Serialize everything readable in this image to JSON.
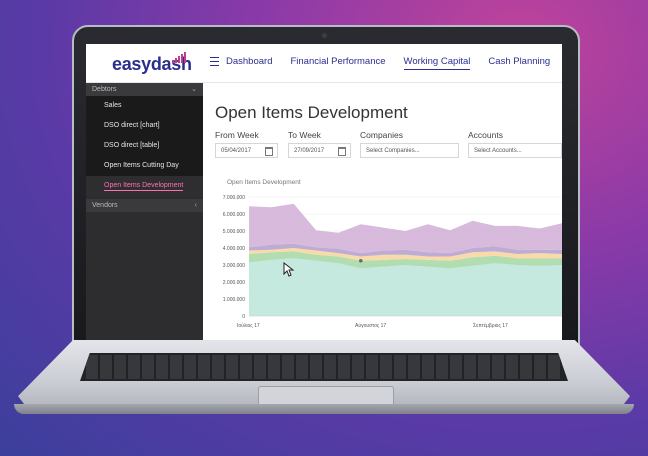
{
  "app": {
    "logo": {
      "easy": "easy",
      "dash": "dash"
    },
    "nav": {
      "items": [
        "Dashboard",
        "Financial Performance",
        "Working Capital",
        "Cash Planning"
      ],
      "active": "Working Capital"
    }
  },
  "sidebar": {
    "debtors_label": "Debtors",
    "items": [
      "Sales",
      "DSO direct [chart]",
      "DSO direct [table]",
      "Open Items Cutting Day",
      "Open Items Development"
    ],
    "active_item": "Open Items Development",
    "vendors_label": "Vendors"
  },
  "page": {
    "title": "Open Items Development",
    "filters": {
      "from_week": {
        "label": "From Week",
        "value": "05/04/2017"
      },
      "to_week": {
        "label": "To Week",
        "value": "27/09/2017"
      },
      "companies": {
        "label": "Companies",
        "placeholder": "Select Companies..."
      },
      "accounts": {
        "label": "Accounts",
        "placeholder": "Select Accounts..."
      }
    }
  },
  "chart_data": {
    "type": "area",
    "title": "Open Items Development",
    "y_ticks": [
      "7.000.000",
      "6.000.000",
      "5.000.000",
      "4.000.000",
      "3.000.000",
      "2.000.000",
      "1.000.000",
      "0"
    ],
    "ylim": [
      0,
      7000000
    ],
    "x_tick_labels": [
      "Ιούλιος 17",
      "Αύγουστος 17",
      "Σεπτέμβριος 17"
    ],
    "stacked": true,
    "series": [
      {
        "color": "#bfe6dc",
        "values": [
          3150000,
          3300000,
          3400000,
          3250000,
          3100000,
          2800000,
          2900000,
          3000000,
          2900000,
          2800000,
          2950000,
          3100000,
          3000000,
          2950000,
          3000000
        ]
      },
      {
        "color": "#a8d9a8",
        "values": [
          500000,
          450000,
          400000,
          350000,
          400000,
          450000,
          400000,
          350000,
          400000,
          450000,
          500000,
          450000,
          400000,
          450000,
          400000
        ]
      },
      {
        "color": "#f7d7a0",
        "values": [
          200000,
          150000,
          200000,
          250000,
          200000,
          250000,
          300000,
          250000,
          200000,
          250000,
          300000,
          250000,
          250000,
          300000,
          250000
        ]
      },
      {
        "color": "#b8a3cf",
        "values": [
          200000,
          300000,
          250000,
          200000,
          250000,
          200000,
          250000,
          300000,
          250000,
          200000,
          250000,
          300000,
          250000,
          200000,
          250000
        ]
      },
      {
        "color": "#d3b3d8",
        "values": [
          2400000,
          2200000,
          2350000,
          1000000,
          950000,
          1700000,
          1350000,
          1100000,
          1650000,
          1350000,
          1600000,
          1200000,
          1400000,
          1250000,
          1550000
        ]
      }
    ],
    "hover_series_color": "#6a6a6a"
  }
}
